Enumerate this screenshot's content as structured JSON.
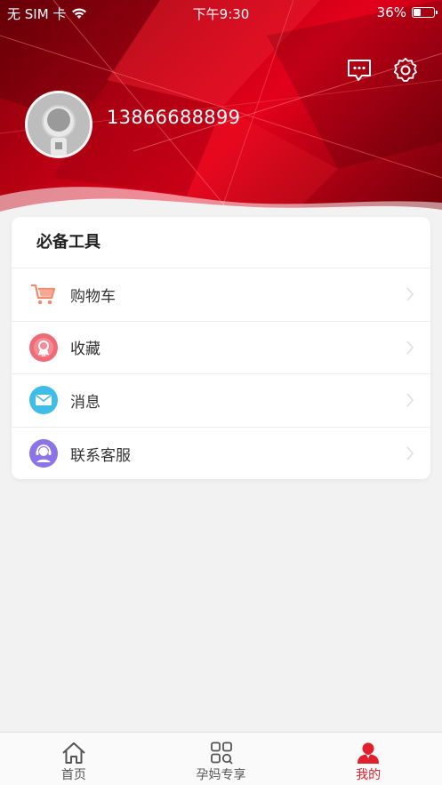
{
  "status_bar": {
    "carrier": "无 SIM 卡",
    "time": "下午9:30",
    "battery": "36%"
  },
  "header": {
    "phone": "13866688899",
    "icons": [
      "message-icon",
      "settings-icon"
    ]
  },
  "tools": {
    "title": "必备工具",
    "items": [
      {
        "label": "购物车",
        "icon": "cart-icon",
        "color": "#f08a6f"
      },
      {
        "label": "收藏",
        "icon": "favorite-badge-icon",
        "color": "#f06b78"
      },
      {
        "label": "消息",
        "icon": "mail-icon",
        "color": "#3fbde6"
      },
      {
        "label": "联系客服",
        "icon": "customer-service-icon",
        "color": "#8c74e6"
      }
    ]
  },
  "tabbar": {
    "items": [
      {
        "label": "首页",
        "icon": "home-icon"
      },
      {
        "label": "孕妈专享",
        "icon": "grid-search-icon"
      },
      {
        "label": "我的",
        "icon": "user-icon",
        "active": true
      }
    ],
    "active_color": "#e0202c"
  }
}
